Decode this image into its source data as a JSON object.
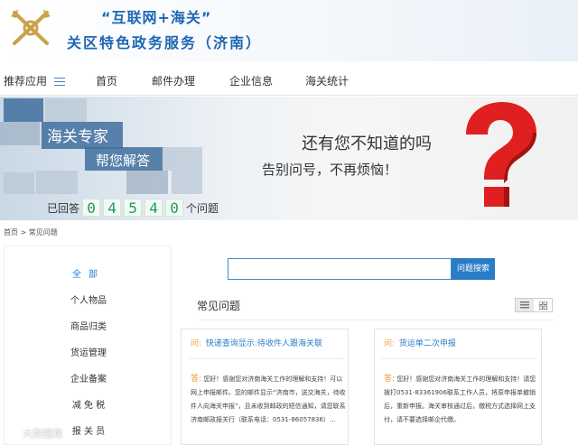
{
  "header": {
    "title_line1": "“互联网+海关”",
    "title_line2": "关区特色政务服务（济南）",
    "logo_icon": "customs-emblem-icon"
  },
  "nav": {
    "items": [
      {
        "label": "推荐应用"
      },
      {
        "label": "首页"
      },
      {
        "label": "邮件办理"
      },
      {
        "label": "企业信息"
      },
      {
        "label": "海关统计"
      }
    ]
  },
  "banner": {
    "expert_title": "海关专家",
    "expert_sub": "帮您解答",
    "slogan1": "还有您不知道的吗",
    "slogan2": "告别问号，不再烦恼！",
    "answered_prefix": "已回答",
    "answered_digits": [
      "0",
      "4",
      "5",
      "4",
      "0"
    ],
    "answered_suffix": "个问题",
    "question_icon": "red-question-mark-icon"
  },
  "breadcrumb": {
    "home": "首页",
    "separator": ">",
    "current": "常见问题"
  },
  "sidebar": {
    "items": [
      {
        "label": "全部"
      },
      {
        "label": "个人物品"
      },
      {
        "label": "商品归类"
      },
      {
        "label": "货运管理"
      },
      {
        "label": "企业备案"
      },
      {
        "label": "减 免 税"
      },
      {
        "label": "报 关 员"
      }
    ]
  },
  "search": {
    "placeholder": "",
    "button_label": "问题搜索"
  },
  "faq": {
    "title": "常见问题",
    "cards": [
      {
        "q_tag": "问:",
        "question": "快递查询显示:待收件人跟海关联",
        "a_tag": "答:",
        "answer": "您好！感谢您对济南海关工作的理解和支持！可以网上申报邮件。您的邮件显示“济南市，送交海关，待收件人向海关申报”，且未收到邮政的短信通知，请您联系济南邮政报关行（联系电话：0531-86057836）..."
      },
      {
        "q_tag": "问:",
        "question": "货运单二次申报",
        "a_tag": "答:",
        "answer": "您好！感谢您对济南海关工作的理解和支持！请您拨打0531-83361906联系工作人员，将原申报单撤销后，重新申报。海关审核通过后，缴税方式选择网上支付，请不要选择邮企代缴。"
      }
    ]
  },
  "watermark": {
    "text": "大数据观"
  },
  "colors": {
    "brand_blue": "#1e66b3",
    "button_blue": "#2a7cc7",
    "accent_orange": "#e8a033",
    "digit_green": "#1f9a5a",
    "question_red": "#e02020"
  }
}
